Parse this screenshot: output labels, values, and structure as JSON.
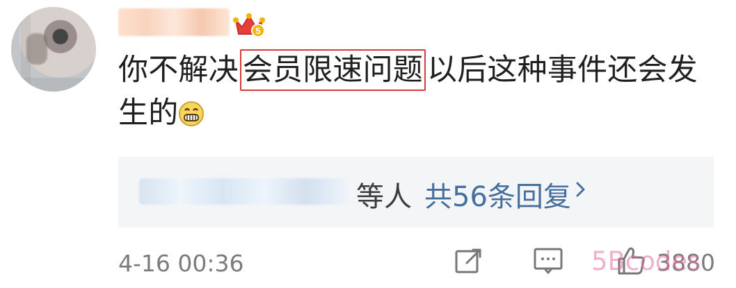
{
  "comment": {
    "before": "你不解决",
    "highlight": "会员限速问题",
    "after": "以后这种事件还会发",
    "last_line": "生的"
  },
  "replies": {
    "suffix": "等人",
    "link": "共56条回复",
    "chevron_icon": "chevron-right-icon"
  },
  "meta": {
    "time": "4-16 00:36",
    "likes": "3880",
    "watermark": "5Bcodes"
  },
  "colors": {
    "highlight_border": "#d63b3b",
    "link": "#456f9f",
    "muted": "#7b7b7b"
  }
}
